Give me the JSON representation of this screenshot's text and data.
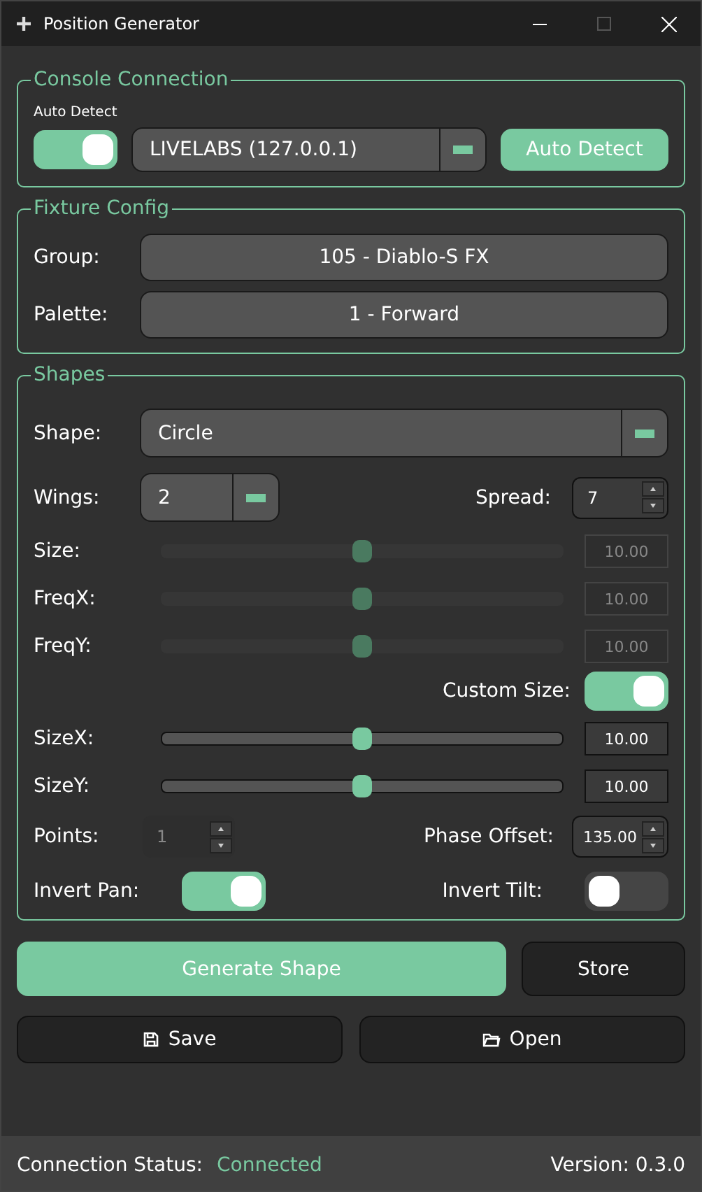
{
  "window": {
    "title": "Position Generator"
  },
  "console_connection": {
    "title": "Console Connection",
    "auto_detect_label": "Auto Detect",
    "auto_detect_on": true,
    "console": "LIVELABS (127.0.0.1)",
    "auto_detect_button": "Auto Detect"
  },
  "fixture_config": {
    "title": "Fixture Config",
    "rows": [
      {
        "label": "Group:",
        "value": "105 - Diablo-S FX"
      },
      {
        "label": "Palette:",
        "value": "1 - Forward"
      }
    ]
  },
  "shapes": {
    "title": "Shapes",
    "shape": {
      "label": "Shape:",
      "value": "Circle"
    },
    "wings": {
      "label": "Wings:",
      "value": "2"
    },
    "spread": {
      "label": "Spread:",
      "value": "7"
    },
    "sliders": [
      {
        "label": "Size:",
        "level": 0.5,
        "value": "10.00",
        "disabled": true
      },
      {
        "label": "FreqX:",
        "level": 0.5,
        "value": "10.00",
        "disabled": true
      },
      {
        "label": "FreqY:",
        "level": 0.5,
        "value": "10.00",
        "disabled": true
      }
    ],
    "custom_size": {
      "label": "Custom Size:",
      "on": true
    },
    "size_sliders": [
      {
        "label": "SizeX:",
        "level": 0.5,
        "value": "10.00",
        "disabled": false
      },
      {
        "label": "SizeY:",
        "level": 0.5,
        "value": "10.00",
        "disabled": false
      }
    ],
    "points": {
      "label": "Points:",
      "value": "1",
      "disabled": true
    },
    "phase_offset": {
      "label": "Phase Offset:",
      "value": "135.00",
      "disabled": false
    },
    "invert_pan": {
      "label": "Invert Pan:",
      "on": true
    },
    "invert_tilt": {
      "label": "Invert Tilt:",
      "on": false
    }
  },
  "actions": [
    {
      "label": "Generate Shape",
      "kind": "primary"
    },
    {
      "label": "Store",
      "kind": "secondary"
    }
  ],
  "file_buttons": [
    {
      "label": "Save",
      "kind": "save"
    },
    {
      "label": "Open",
      "kind": "open"
    }
  ],
  "status_bar": {
    "label": "Connection Status:",
    "status": "Connected",
    "version": "Version: 0.3.0"
  }
}
